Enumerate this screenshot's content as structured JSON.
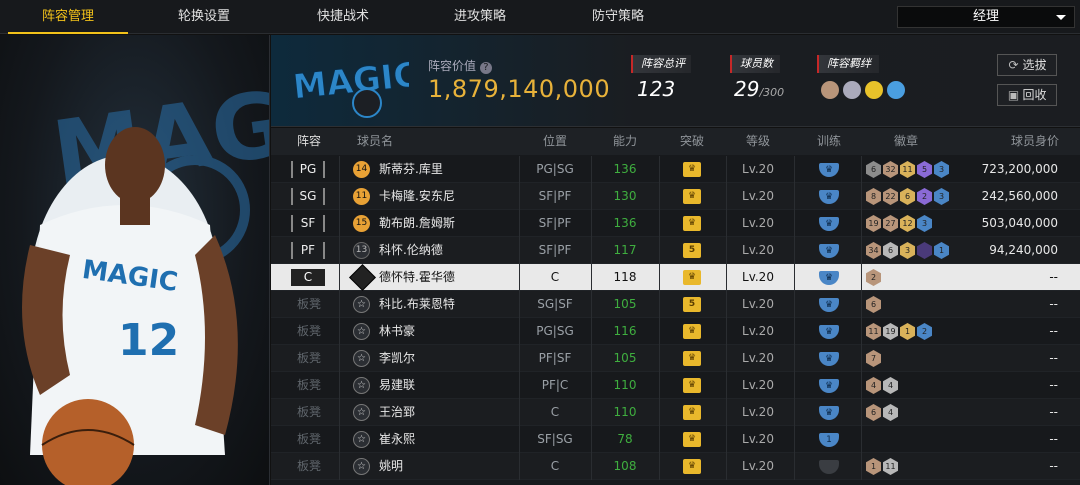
{
  "nav": {
    "tabs": [
      "阵容管理",
      "轮换设置",
      "快捷战术",
      "进攻策略",
      "防守策略"
    ],
    "active_tab": 0,
    "dropdown_value": "经理"
  },
  "header": {
    "team_logo_text": "MAGIC",
    "lineup_value_label": "阵容价值",
    "lineup_value": "1,879,140,000",
    "overall_label": "阵容总评",
    "overall_value": "123",
    "player_count_label": "球员数",
    "player_count": "29",
    "player_count_max": "/300",
    "bond_label": "阵容羁绊",
    "select_button": "选拔",
    "recycle_button": "回收"
  },
  "player_panel": {
    "jersey_text": "MAGIC",
    "jersey_number": "12"
  },
  "table": {
    "columns": [
      "阵容",
      "球员名",
      "位置",
      "能力",
      "突破",
      "等级",
      "训练",
      "徽章",
      "球员身价"
    ],
    "rows": [
      {
        "slot": "PG",
        "badge": "14",
        "badge_type": "num",
        "name": "斯蒂芬.库里",
        "position": "PG|SG",
        "ability": "136",
        "breakthrough": "crown",
        "level": "Lv.20",
        "train": "crown",
        "badges": [
          {
            "v": "6",
            "c": "#8c8c8c"
          },
          {
            "v": "32",
            "c": "#b8957a"
          },
          {
            "v": "11",
            "c": "#d9b25a"
          },
          {
            "v": "5",
            "c": "#8a6ad6"
          },
          {
            "v": "3",
            "c": "#4a86c6"
          }
        ],
        "salary": "723,200,000"
      },
      {
        "slot": "SG",
        "badge": "11",
        "badge_type": "num",
        "name": "卡梅隆.安东尼",
        "position": "SF|PF",
        "ability": "130",
        "breakthrough": "crown",
        "level": "Lv.20",
        "train": "crown",
        "badges": [
          {
            "v": "8",
            "c": "#b8957a"
          },
          {
            "v": "22",
            "c": "#b8957a"
          },
          {
            "v": "6",
            "c": "#d9b25a"
          },
          {
            "v": "2",
            "c": "#8a6ad6"
          },
          {
            "v": "3",
            "c": "#4a86c6"
          }
        ],
        "salary": "242,560,000"
      },
      {
        "slot": "SF",
        "badge": "15",
        "badge_type": "num",
        "name": "勒布朗.詹姆斯",
        "position": "SF|PF",
        "ability": "136",
        "breakthrough": "crown",
        "level": "Lv.20",
        "train": "crown",
        "badges": [
          {
            "v": "19",
            "c": "#b8957a"
          },
          {
            "v": "27",
            "c": "#b8957a"
          },
          {
            "v": "12",
            "c": "#d9b25a"
          },
          {
            "v": "3",
            "c": "#4a86c6"
          }
        ],
        "salary": "503,040,000"
      },
      {
        "slot": "PF",
        "badge": "13",
        "badge_type": "dim",
        "name": "科怀.伦纳德",
        "position": "SF|PF",
        "ability": "117",
        "breakthrough": "5",
        "level": "Lv.20",
        "train": "crown",
        "badges": [
          {
            "v": "34",
            "c": "#b8957a"
          },
          {
            "v": "6",
            "c": "#b8b8b8"
          },
          {
            "v": "3",
            "c": "#d9b25a"
          },
          {
            "v": "",
            "c": "#4a3a7a"
          },
          {
            "v": "1",
            "c": "#4a86c6"
          }
        ],
        "salary": "94,240,000"
      },
      {
        "slot": "C",
        "badge": "",
        "badge_type": "copy",
        "name": "德怀特.霍华德",
        "position": "C",
        "ability": "118",
        "breakthrough": "crown",
        "level": "Lv.20",
        "train": "crown",
        "badges": [
          {
            "v": "2",
            "c": "#b8957a"
          }
        ],
        "salary": "--",
        "selected": true
      },
      {
        "slot": "板凳",
        "badge": "",
        "badge_type": "star",
        "name": "科比.布莱恩特",
        "position": "SG|SF",
        "ability": "105",
        "breakthrough": "5",
        "level": "Lv.20",
        "train": "crown",
        "badges": [
          {
            "v": "6",
            "c": "#b8957a"
          }
        ],
        "salary": "--"
      },
      {
        "slot": "板凳",
        "badge": "",
        "badge_type": "star",
        "name": "林书豪",
        "position": "PG|SG",
        "ability": "116",
        "breakthrough": "crown",
        "level": "Lv.20",
        "train": "crown",
        "badges": [
          {
            "v": "11",
            "c": "#b8957a"
          },
          {
            "v": "19",
            "c": "#b8b8b8"
          },
          {
            "v": "1",
            "c": "#d9b25a"
          },
          {
            "v": "2",
            "c": "#4a86c6"
          }
        ],
        "salary": "--"
      },
      {
        "slot": "板凳",
        "badge": "",
        "badge_type": "star",
        "name": "李凯尔",
        "position": "PF|SF",
        "ability": "105",
        "breakthrough": "crown",
        "level": "Lv.20",
        "train": "crown",
        "badges": [
          {
            "v": "7",
            "c": "#b8957a"
          }
        ],
        "salary": "--"
      },
      {
        "slot": "板凳",
        "badge": "",
        "badge_type": "star",
        "name": "易建联",
        "position": "PF|C",
        "ability": "110",
        "breakthrough": "crown",
        "level": "Lv.20",
        "train": "crown",
        "badges": [
          {
            "v": "4",
            "c": "#b8957a"
          },
          {
            "v": "4",
            "c": "#b8b8b8"
          }
        ],
        "salary": "--"
      },
      {
        "slot": "板凳",
        "badge": "",
        "badge_type": "star",
        "name": "王治郅",
        "position": "C",
        "ability": "110",
        "breakthrough": "crown",
        "level": "Lv.20",
        "train": "crown",
        "badges": [
          {
            "v": "6",
            "c": "#b8957a"
          },
          {
            "v": "4",
            "c": "#b8b8b8"
          }
        ],
        "salary": "--"
      },
      {
        "slot": "板凳",
        "badge": "",
        "badge_type": "star",
        "name": "崔永熙",
        "position": "SF|SG",
        "ability": "78",
        "breakthrough": "crown",
        "level": "Lv.20",
        "train": "1",
        "badges": [],
        "salary": "--"
      },
      {
        "slot": "板凳",
        "badge": "",
        "badge_type": "star",
        "name": "姚明",
        "position": "C",
        "ability": "108",
        "breakthrough": "crown",
        "level": "Lv.20",
        "train": "dark",
        "badges": [
          {
            "v": "1",
            "c": "#b8957a"
          },
          {
            "v": "11",
            "c": "#b8b8b8"
          }
        ],
        "salary": "--"
      }
    ]
  },
  "colors": {
    "accent": "#f2c21a",
    "value_gold": "#e8b23a",
    "ability_green": "#3fae3f",
    "train_blue": "#4a86c6"
  },
  "icons": {
    "info": "help-circle-icon",
    "select": "refresh-icon",
    "recycle": "recycle-icon"
  }
}
